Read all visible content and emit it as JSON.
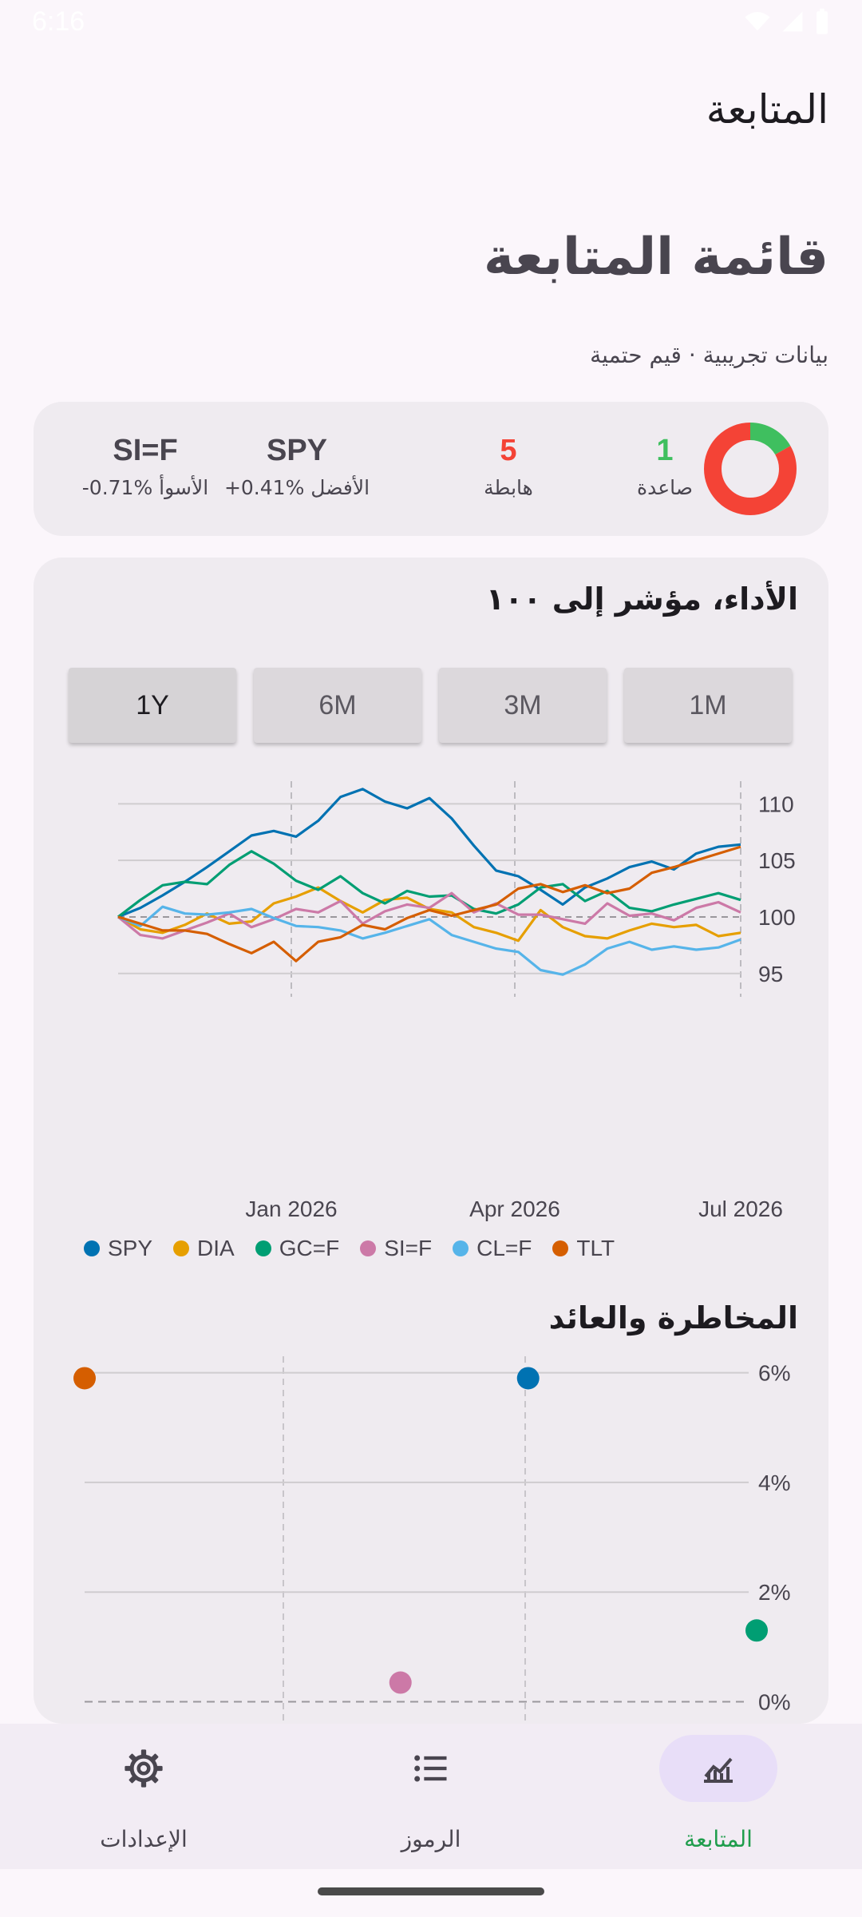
{
  "status_bar": {
    "time": "6:16"
  },
  "app_bar": {
    "title": "المتابعة"
  },
  "page": {
    "title": "قائمة المتابعة",
    "subtitle": "بيانات تجريبية · قيم حتمية"
  },
  "summary": {
    "up_count": "1",
    "up_label": "صاعدة",
    "down_count": "5",
    "down_label": "هابطة",
    "best_symbol": "SPY",
    "best_text": "الأفضل ‎+0.41%",
    "worst_symbol": "SI=F",
    "worst_text": "الأسوأ ‎-0.71%",
    "colors": {
      "up": "#3fbf5f",
      "down": "#f44336"
    }
  },
  "performance": {
    "title": "الأداء، مؤشر إلى ١٠٠",
    "ranges": [
      "1M",
      "3M",
      "6M",
      "1Y"
    ],
    "selected_range": "1Y"
  },
  "risk_return": {
    "title": "المخاطرة والعائد"
  },
  "bottom_nav": [
    {
      "label": "المتابعة",
      "icon": "chart-icon",
      "active": true
    },
    {
      "label": "الرموز",
      "icon": "list-icon",
      "active": false
    },
    {
      "label": "الإعدادات",
      "icon": "gear-icon",
      "active": false
    }
  ],
  "chart_data": [
    {
      "type": "line",
      "x_ticks": [
        "Jan 2026",
        "Apr 2026",
        "Jul 2026"
      ],
      "y_ticks": [
        95,
        100,
        105,
        110
      ],
      "ylim": [
        93.5,
        112
      ],
      "grid": true,
      "legend_placement": "bottom",
      "series": [
        {
          "name": "SPY",
          "color": "#0072b2",
          "values": [
            100,
            100.8,
            101.9,
            103.1,
            104.4,
            105.8,
            107.2,
            107.6,
            107.1,
            108.5,
            110.6,
            111.3,
            110.2,
            109.6,
            110.5,
            108.7,
            106.3,
            104.1,
            103.6,
            102.4,
            101.1,
            102.6,
            103.4,
            104.4,
            104.9,
            104.2,
            105.6,
            106.2,
            106.4
          ]
        },
        {
          "name": "DIA",
          "color": "#e69f00",
          "values": [
            100,
            98.9,
            98.6,
            99.3,
            100.3,
            99.4,
            99.6,
            101.2,
            101.8,
            102.6,
            101.4,
            100.4,
            101.5,
            101.7,
            100.7,
            100.4,
            99.1,
            98.6,
            97.9,
            100.6,
            99.1,
            98.3,
            98.1,
            98.8,
            99.4,
            99.1,
            99.3,
            98.3,
            98.6
          ]
        },
        {
          "name": "GC=F",
          "color": "#009e73",
          "values": [
            100,
            101.5,
            102.8,
            103.1,
            102.9,
            104.6,
            105.8,
            104.7,
            103.2,
            102.4,
            103.6,
            102.1,
            101.2,
            102.3,
            101.8,
            101.9,
            100.7,
            100.3,
            101.1,
            102.6,
            102.9,
            101.4,
            102.3,
            100.8,
            100.5,
            101.1,
            101.6,
            102.1,
            101.5
          ]
        },
        {
          "name": "SI=F",
          "color": "#cc79a7",
          "values": [
            100,
            98.4,
            98.1,
            98.8,
            99.5,
            100.3,
            99.1,
            99.8,
            100.7,
            100.4,
            101.4,
            99.4,
            100.5,
            101.1,
            100.8,
            102.1,
            100.4,
            101.2,
            100.2,
            100.2,
            99.8,
            99.4,
            101.2,
            100.1,
            100.3,
            99.7,
            100.8,
            101.3,
            100.4
          ]
        },
        {
          "name": "CL=F",
          "color": "#56b4e9",
          "values": [
            100,
            99.2,
            100.9,
            100.3,
            100.2,
            100.4,
            100.7,
            99.9,
            99.2,
            99.1,
            98.8,
            98.1,
            98.6,
            99.2,
            99.8,
            98.4,
            97.8,
            97.2,
            96.9,
            95.3,
            94.9,
            95.8,
            97.2,
            97.8,
            97.1,
            97.4,
            97.1,
            97.3,
            98
          ]
        },
        {
          "name": "TLT",
          "color": "#d55e00",
          "values": [
            100,
            99.4,
            98.8,
            98.8,
            98.5,
            97.6,
            96.8,
            97.8,
            96.1,
            97.8,
            98.2,
            99.3,
            98.9,
            99.9,
            100.6,
            100.1,
            100.6,
            101.1,
            102.5,
            102.9,
            102.2,
            102.8,
            102.1,
            102.5,
            103.9,
            104.4,
            105,
            105.6,
            106.2
          ]
        }
      ]
    },
    {
      "type": "scatter",
      "y_ticks": [
        "0%",
        "2%",
        "4%",
        "6%"
      ],
      "ylim": [
        -0.4,
        6.3
      ],
      "grid": true,
      "points": [
        {
          "series": "TLT",
          "color": "#d55e00",
          "x": 0,
          "y": 5.9
        },
        {
          "series": "SPY",
          "color": "#0072b2",
          "x": 0.66,
          "y": 5.9
        },
        {
          "series": "GC=F",
          "color": "#009e73",
          "x": 1.0,
          "y": 1.3
        },
        {
          "series": "SI=F",
          "color": "#cc79a7",
          "x": 0.47,
          "y": 0.35
        }
      ]
    }
  ]
}
